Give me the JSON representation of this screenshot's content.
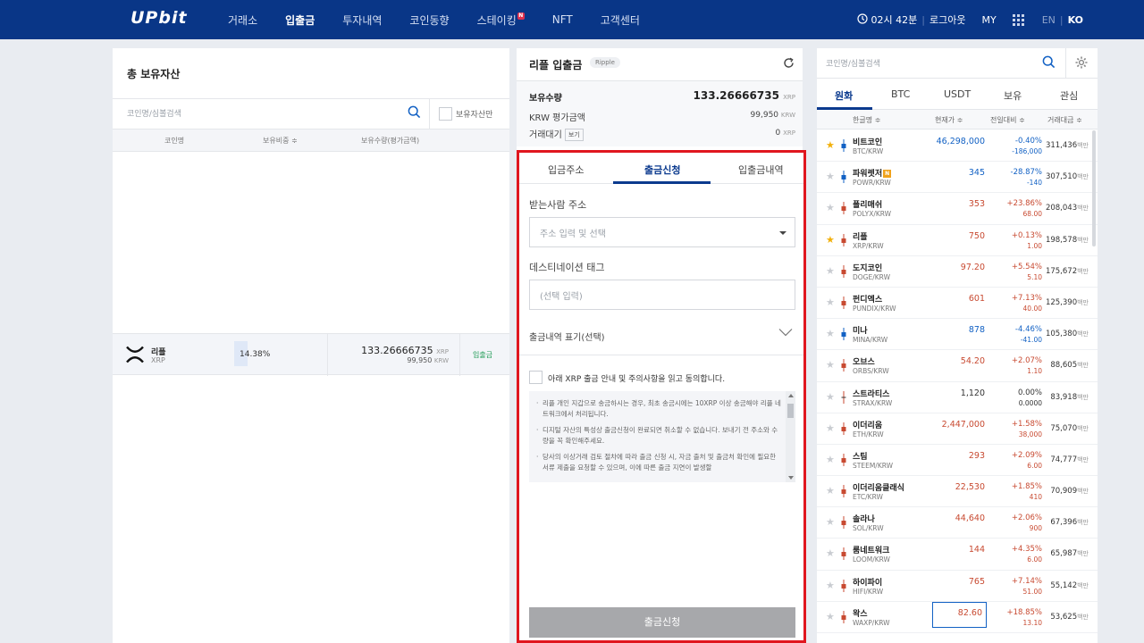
{
  "header": {
    "logo": "UPbit",
    "nav": [
      {
        "label": "거래소",
        "active": false
      },
      {
        "label": "입출금",
        "active": true
      },
      {
        "label": "투자내역",
        "active": false
      },
      {
        "label": "코인동향",
        "active": false
      },
      {
        "label": "스테이킹",
        "active": false,
        "badge": "N"
      },
      {
        "label": "NFT",
        "active": false
      },
      {
        "label": "고객센터",
        "active": false
      }
    ],
    "timer": "02시 42분",
    "logout": "로그아웃",
    "my": "MY",
    "lang_en": "EN",
    "lang_ko": "KO",
    "lang_sep": "|"
  },
  "assets": {
    "title": "총 보유자산",
    "search_placeholder": "코인명/심볼검색",
    "only_owned_label": "보유자산만",
    "columns": [
      "코인명",
      "보유비중 ≑",
      "보유수량(평가금액)"
    ],
    "row": {
      "name": "리플",
      "symbol": "XRP",
      "share": "14.38%",
      "share_fraction": 0.1438,
      "quantity": "133.26666735",
      "quantity_unit": "XRP",
      "value": "99,950",
      "value_unit": "KRW",
      "action": "입출금"
    }
  },
  "transfer": {
    "title": "리플 입출금",
    "badge": "Ripple",
    "holding_label": "보유수량",
    "holding_value": "133.26666735",
    "holding_unit": "XRP",
    "krw_label": "KRW 평가금액",
    "krw_value": "99,950",
    "krw_unit": "KRW",
    "pending_label": "거래대기",
    "pending_view": "보기",
    "pending_value": "0",
    "pending_unit": "XRP",
    "tabs": [
      "입금주소",
      "출금신청",
      "입출금내역"
    ],
    "active_tab": "출금신청",
    "recipient_label": "받는사람 주소",
    "recipient_placeholder": "주소 입력 및 선택",
    "dest_tag_label": "데스티네이션 태그",
    "dest_tag_placeholder": "(선택 입력)",
    "memo_label": "출금내역 표기(선택)",
    "agree_label": "아래 XRP 출금 안내 및 주의사항을 읽고 동의합니다.",
    "notices": [
      "리플 개인 지갑으로 송금하시는 경우, 최초 송금시에는 10XRP 이상 송금해야 리플 네트워크에서 처리됩니다.",
      "디지털 자산의 특성상 출금신청이 완료되면 취소할 수 없습니다. 보내기 전 주소와 수량을 꼭 확인해주세요.",
      "당사의 이상거래 검토 절차에 따라 출금 신청 시, 자금 출처 및 출금처 확인에 필요한 서류 제출을 요청할 수 있으며, 이에 따른 출금 지연이 발생할"
    ],
    "submit_label": "출금신청",
    "highlight_color": "#e0161e"
  },
  "market": {
    "search_placeholder": "코인명/심볼검색",
    "tabs": [
      "원화",
      "BTC",
      "USDT",
      "보유",
      "관심"
    ],
    "active_tab": "원화",
    "columns": [
      "한글명 ≑",
      "현재가 ≑",
      "전일대비 ≑",
      "거래대금 ≑"
    ],
    "vol_unit": "백만",
    "coins": [
      {
        "name": "비트코인",
        "pair": "BTC/KRW",
        "price": "46,298,000",
        "rate": "-0.40%",
        "diff": "-186,000",
        "vol": "311,436",
        "dir": "down",
        "fav": true
      },
      {
        "name": "파워렛저",
        "pair": "POWR/KRW",
        "price": "345",
        "rate": "-28.87%",
        "diff": "-140",
        "vol": "307,510",
        "dir": "down",
        "fav": false,
        "new": true
      },
      {
        "name": "폴리매쉬",
        "pair": "POLYX/KRW",
        "price": "353",
        "rate": "+23.86%",
        "diff": "68.00",
        "vol": "208,043",
        "dir": "up",
        "fav": false
      },
      {
        "name": "리플",
        "pair": "XRP/KRW",
        "price": "750",
        "rate": "+0.13%",
        "diff": "1.00",
        "vol": "198,578",
        "dir": "up",
        "fav": true
      },
      {
        "name": "도지코인",
        "pair": "DOGE/KRW",
        "price": "97.20",
        "rate": "+5.54%",
        "diff": "5.10",
        "vol": "175,672",
        "dir": "up",
        "fav": false
      },
      {
        "name": "펀디엑스",
        "pair": "PUNDIX/KRW",
        "price": "601",
        "rate": "+7.13%",
        "diff": "40.00",
        "vol": "125,390",
        "dir": "up",
        "fav": false
      },
      {
        "name": "미나",
        "pair": "MINA/KRW",
        "price": "878",
        "rate": "-4.46%",
        "diff": "-41.00",
        "vol": "105,380",
        "dir": "down",
        "fav": false
      },
      {
        "name": "오브스",
        "pair": "ORBS/KRW",
        "price": "54.20",
        "rate": "+2.07%",
        "diff": "1.10",
        "vol": "88,605",
        "dir": "up",
        "fav": false
      },
      {
        "name": "스트라티스",
        "pair": "STRAX/KRW",
        "price": "1,120",
        "rate": "0.00%",
        "diff": "0.0000",
        "vol": "83,918",
        "dir": "flat",
        "fav": false
      },
      {
        "name": "이더리움",
        "pair": "ETH/KRW",
        "price": "2,447,000",
        "rate": "+1.58%",
        "diff": "38,000",
        "vol": "75,070",
        "dir": "up",
        "fav": false
      },
      {
        "name": "스팀",
        "pair": "STEEM/KRW",
        "price": "293",
        "rate": "+2.09%",
        "diff": "6.00",
        "vol": "74,777",
        "dir": "up",
        "fav": false
      },
      {
        "name": "이더리움클래식",
        "pair": "ETC/KRW",
        "price": "22,530",
        "rate": "+1.85%",
        "diff": "410",
        "vol": "70,909",
        "dir": "up",
        "fav": false
      },
      {
        "name": "솔라나",
        "pair": "SOL/KRW",
        "price": "44,640",
        "rate": "+2.06%",
        "diff": "900",
        "vol": "67,396",
        "dir": "up",
        "fav": false
      },
      {
        "name": "룸네트워크",
        "pair": "LOOM/KRW",
        "price": "144",
        "rate": "+4.35%",
        "diff": "6.00",
        "vol": "65,987",
        "dir": "up",
        "fav": false
      },
      {
        "name": "하이파이",
        "pair": "HIFI/KRW",
        "price": "765",
        "rate": "+7.14%",
        "diff": "51.00",
        "vol": "55,142",
        "dir": "up",
        "fav": false
      },
      {
        "name": "왁스",
        "pair": "WAXP/KRW",
        "price": "82.60",
        "rate": "+18.85%",
        "diff": "13.10",
        "vol": "53,625",
        "dir": "up",
        "fav": false,
        "boxed": true
      }
    ],
    "colors": {
      "up": "#c84a31",
      "down": "#1261c4",
      "accent": "#093687"
    }
  }
}
